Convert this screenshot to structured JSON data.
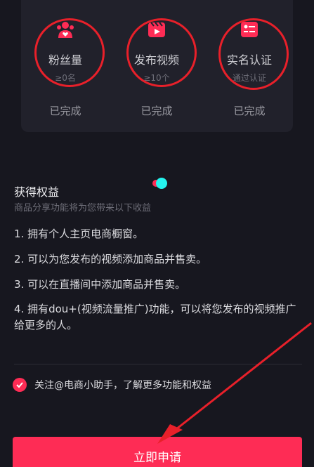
{
  "requirements": [
    {
      "title": "粉丝量",
      "sub": "≥0名",
      "status": "已完成",
      "icon": "fans-icon"
    },
    {
      "title": "发布视频",
      "sub": "≥10个",
      "status": "已完成",
      "icon": "video-icon"
    },
    {
      "title": "实名认证",
      "sub": "通过认证",
      "status": "已完成",
      "icon": "id-card-icon"
    }
  ],
  "benefits": {
    "title": "获得权益",
    "subtitle": "商品分享功能将为您带来以下收益",
    "items": [
      "1. 拥有个人主页电商橱窗。",
      "2. 可以为您发布的视频添加商品并售卖。",
      "3. 可以在直播间中添加商品并售卖。",
      "4. 拥有dou+(视频流量推广)功能，可以将您发布的视频推广给更多的人。"
    ]
  },
  "follow": {
    "label": "关注@电商小助手，了解更多功能和权益",
    "checked": true
  },
  "apply_button": {
    "label": "立即申请"
  },
  "colors": {
    "accent": "#fe2c55",
    "annotation": "#e8202a",
    "background": "#17171f"
  }
}
